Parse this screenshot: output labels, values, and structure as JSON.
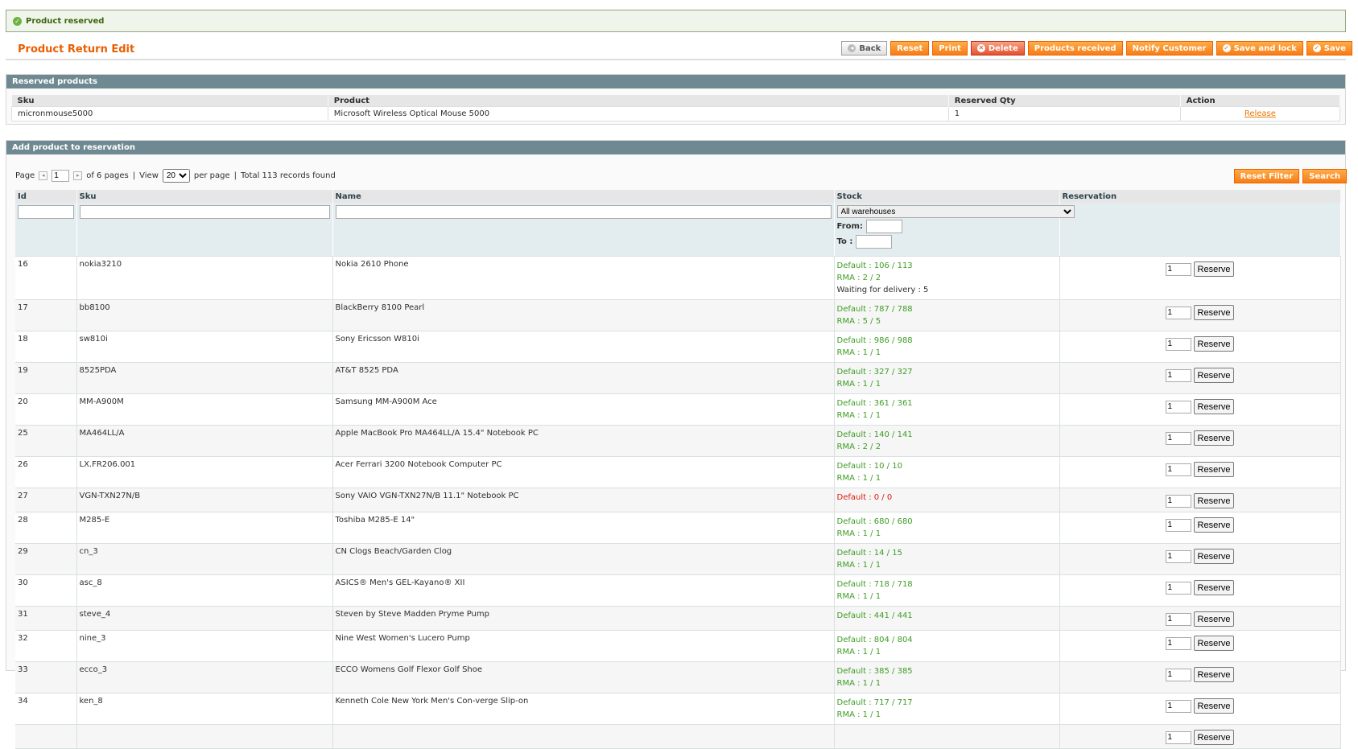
{
  "message": {
    "text": "Product reserved"
  },
  "page": {
    "title": "Product Return Edit"
  },
  "toolbar": [
    {
      "label": "Back",
      "icon": "back-icon",
      "kind": "back"
    },
    {
      "label": "Reset",
      "kind": "normal"
    },
    {
      "label": "Print",
      "kind": "normal"
    },
    {
      "label": "Delete",
      "icon": "delete-icon",
      "kind": "del"
    },
    {
      "label": "Products received",
      "kind": "normal"
    },
    {
      "label": "Notify Customer",
      "kind": "normal"
    },
    {
      "label": "Save and lock",
      "icon": "check-icon",
      "kind": "normal"
    },
    {
      "label": "Save",
      "icon": "check-icon",
      "kind": "normal"
    }
  ],
  "reserved": {
    "title": "Reserved products",
    "columns": [
      "Sku",
      "Product",
      "Reserved Qty",
      "Action"
    ],
    "rows": [
      {
        "sku": "micronmouse5000",
        "product": "Microsoft Wireless Optical Mouse 5000",
        "qty": "1",
        "action": "Release"
      }
    ]
  },
  "add": {
    "title": "Add product to reservation",
    "pager": {
      "page_label": "Page",
      "page": "1",
      "of_pages": "of 6 pages",
      "sep": "|",
      "view_label": "View",
      "per_page": "20",
      "per_page_label": "per page",
      "total": "Total 113 records found"
    },
    "reset_filter": "Reset Filter",
    "search": "Search",
    "columns": [
      "Id",
      "Sku",
      "Name",
      "Stock",
      "Reservation"
    ],
    "filter": {
      "warehouse": "All warehouses",
      "from": "From:",
      "to": "To :"
    },
    "reserve_label": "Reserve",
    "rows": [
      {
        "id": "16",
        "sku": "nokia3210",
        "name": "Nokia 2610 Phone",
        "default": "Default : 106 / 113",
        "rma": "RMA : 2 / 2",
        "waiting": "Waiting for delivery : 5",
        "qty": "1"
      },
      {
        "id": "17",
        "sku": "bb8100",
        "name": "BlackBerry 8100 Pearl",
        "default": "Default : 787 / 788",
        "rma": "RMA : 5 / 5",
        "qty": "1"
      },
      {
        "id": "18",
        "sku": "sw810i",
        "name": "Sony Ericsson W810i",
        "default": "Default : 986 / 988",
        "rma": "RMA : 1 / 1",
        "qty": "1"
      },
      {
        "id": "19",
        "sku": "8525PDA",
        "name": "AT&T 8525 PDA",
        "default": "Default : 327 / 327",
        "rma": "RMA : 1 / 1",
        "qty": "1"
      },
      {
        "id": "20",
        "sku": "MM-A900M",
        "name": "Samsung MM-A900M Ace",
        "default": "Default : 361 / 361",
        "rma": "RMA : 1 / 1",
        "qty": "1"
      },
      {
        "id": "25",
        "sku": "MA464LL/A",
        "name": "Apple MacBook Pro MA464LL/A 15.4\" Notebook PC",
        "default": "Default : 140 / 141",
        "rma": "RMA : 2 / 2",
        "qty": "1"
      },
      {
        "id": "26",
        "sku": "LX.FR206.001",
        "name": "Acer Ferrari 3200 Notebook Computer PC",
        "default": "Default : 10 / 10",
        "rma": "RMA : 1 / 1",
        "qty": "1"
      },
      {
        "id": "27",
        "sku": "VGN-TXN27N/B",
        "name": "Sony VAIO VGN-TXN27N/B 11.1\" Notebook PC",
        "default": "Default : 0 / 0",
        "red": true,
        "qty": "1"
      },
      {
        "id": "28",
        "sku": "M285-E",
        "name": "Toshiba M285-E 14\"",
        "default": "Default : 680 / 680",
        "rma": "RMA : 1 / 1",
        "qty": "1"
      },
      {
        "id": "29",
        "sku": "cn_3",
        "name": "CN Clogs Beach/Garden Clog",
        "default": "Default : 14 / 15",
        "rma": "RMA : 1 / 1",
        "qty": "1"
      },
      {
        "id": "30",
        "sku": "asc_8",
        "name": "ASICS® Men's GEL-Kayano® XII",
        "default": "Default : 718 / 718",
        "rma": "RMA : 1 / 1",
        "qty": "1"
      },
      {
        "id": "31",
        "sku": "steve_4",
        "name": "Steven by Steve Madden Pryme Pump",
        "default": "Default : 441 / 441",
        "qty": "1"
      },
      {
        "id": "32",
        "sku": "nine_3",
        "name": "Nine West Women's Lucero Pump",
        "default": "Default : 804 / 804",
        "rma": "RMA : 1 / 1",
        "qty": "1"
      },
      {
        "id": "33",
        "sku": "ecco_3",
        "name": "ECCO Womens Golf Flexor Golf Shoe",
        "default": "Default : 385 / 385",
        "rma": "RMA : 1 / 1",
        "qty": "1"
      },
      {
        "id": "34",
        "sku": "ken_8",
        "name": "Kenneth Cole New York Men's Con-verge Slip-on",
        "default": "Default : 717 / 717",
        "rma": "RMA : 1 / 1",
        "qty": "1"
      },
      {
        "id": "",
        "sku": "",
        "name": "",
        "default": "",
        "qty": "1"
      }
    ]
  }
}
